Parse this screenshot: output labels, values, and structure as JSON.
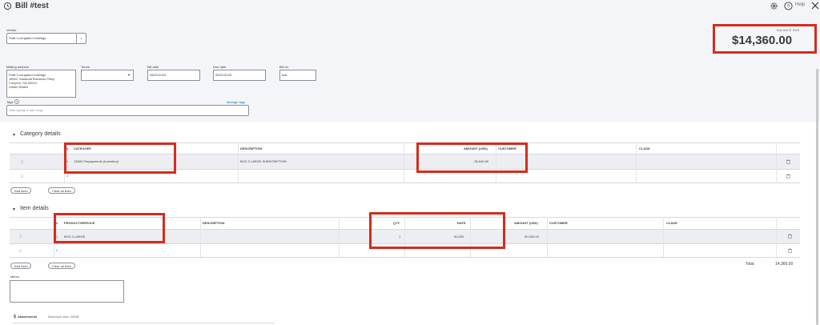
{
  "header": {
    "title": "Bill #test",
    "help_label": "Help"
  },
  "vendor": {
    "label": "Vendor",
    "value": "Pratt Corrugated Holdings"
  },
  "balance": {
    "label": "BALANCE DUE",
    "amount": "$14,360.00"
  },
  "mailing": {
    "label": "Mailing address",
    "value": "Pratt Corrugated Holdings\n1800C Sarasota Business Pkwy\nConyers, GA  30013\nUnited States"
  },
  "terms": {
    "label": "Terms",
    "value": ""
  },
  "bill_date": {
    "label": "Bill date",
    "value": "05/01/2023"
  },
  "due_date": {
    "label": "Due date",
    "value": "05/01/2023"
  },
  "bill_no": {
    "label": "Bill no.",
    "value": "test"
  },
  "tags": {
    "label": "Tags",
    "placeholder": "Start typing to add a tag",
    "manage_label": "Manage tags"
  },
  "category": {
    "title": "Category details",
    "columns": {
      "num": "#",
      "category": "CATEGORY",
      "description": "DESCRIPTION",
      "amount": "AMOUNT (USD)",
      "customer": "CUSTOMER",
      "class": "CLASS"
    },
    "rows": [
      {
        "num": "1",
        "category": "13500 Prepayments (Inventory)",
        "description": "BOX 3 LARGE SUBSCRIPTION",
        "amount": "-35,640.00"
      },
      {
        "num": "2",
        "category": "",
        "description": "",
        "amount": ""
      }
    ],
    "add_lines": "Add lines",
    "clear_lines": "Clear all lines"
  },
  "items": {
    "title": "Item details",
    "columns": {
      "num": "#",
      "product": "PRODUCT/SERVICE",
      "description": "DESCRIPTION",
      "qty": "QTY",
      "rate": "RATE",
      "amount": "AMOUNT (USD)",
      "customer": "CUSTOMER",
      "class": "CLASS"
    },
    "rows": [
      {
        "num": "1",
        "product": "BOX 3 LARGE",
        "description": "",
        "qty": "1",
        "rate": "50,000",
        "amount": "50,000.00"
      },
      {
        "num": "2",
        "product": "",
        "description": "",
        "qty": "",
        "rate": "",
        "amount": ""
      }
    ],
    "add_lines": "Add lines",
    "clear_lines": "Clear all lines"
  },
  "total": {
    "label": "Total",
    "value": "14,360.00"
  },
  "memo": {
    "label": "Memo"
  },
  "attachments": {
    "label": "Attachments",
    "max_size": "Maximum size: 20MB"
  },
  "colors": {
    "highlight": "#d52b1e",
    "link": "#0077c5",
    "panel": "#f4f5f8"
  }
}
